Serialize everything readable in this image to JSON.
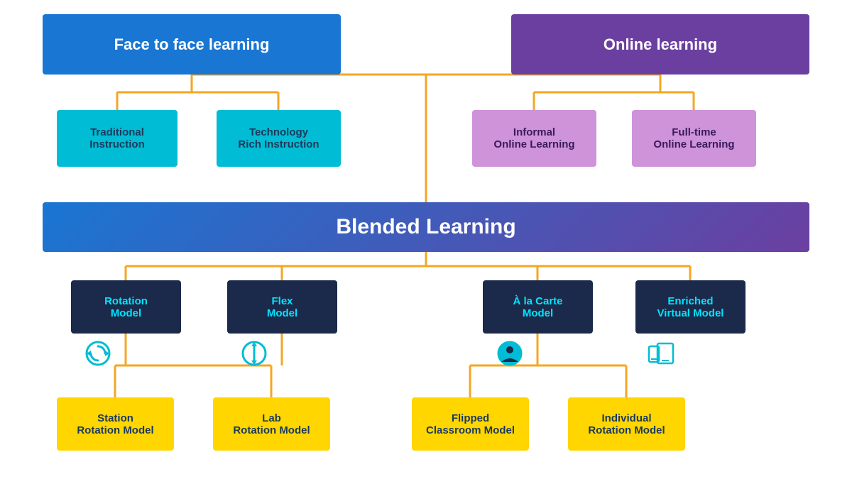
{
  "nodes": {
    "facetoface": {
      "label": "Face to face learning"
    },
    "online": {
      "label": "Online learning"
    },
    "traditional": {
      "label": "Traditional\nInstruction"
    },
    "techrich": {
      "label": "Technology\nRich Instruction"
    },
    "informal": {
      "label": "Informal\nOnline Learning"
    },
    "fulltime": {
      "label": "Full-time\nOnline Learning"
    },
    "blended": {
      "label": "Blended Learning"
    },
    "rotation": {
      "label": "Rotation\nModel"
    },
    "flex": {
      "label": "Flex\nModel"
    },
    "alacarte": {
      "label": "À la Carte\nModel"
    },
    "enriched": {
      "label": "Enriched\nVirtual Model"
    },
    "station": {
      "label": "Station\nRotation Model"
    },
    "lab": {
      "label": "Lab\nRotation Model"
    },
    "flipped": {
      "label": "Flipped\nClassroom Model"
    },
    "individual": {
      "label": "Individual\nRotation Model"
    }
  },
  "colors": {
    "connector": "#F5A623",
    "facetoface_bg": "#1976D2",
    "online_bg": "#6B3FA0"
  }
}
